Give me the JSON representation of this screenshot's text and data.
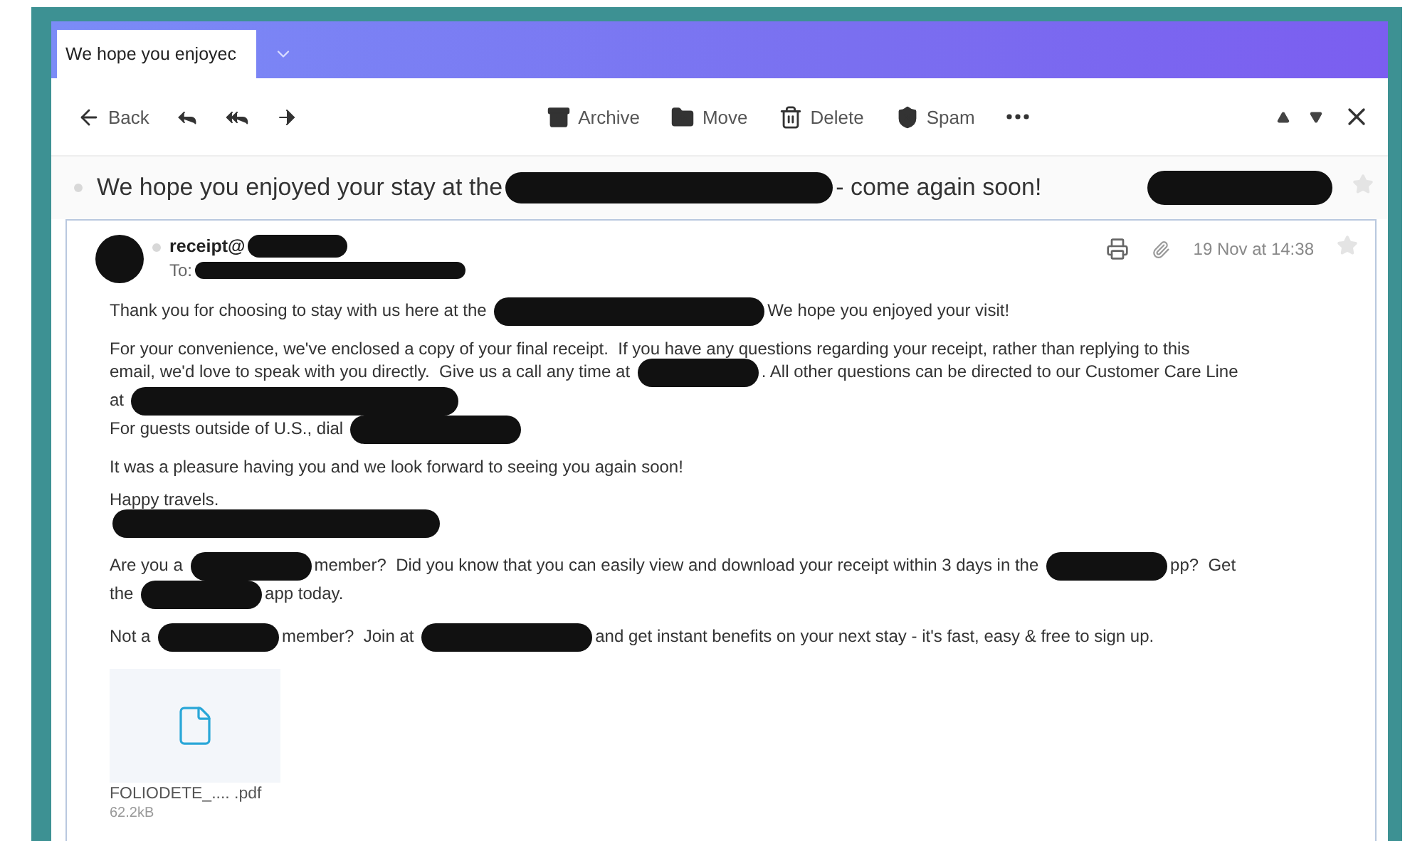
{
  "tab": {
    "title": "We hope you enjoyec"
  },
  "toolbar": {
    "left": [
      {
        "kind": "back",
        "label": "Back"
      },
      {
        "kind": "reply"
      },
      {
        "kind": "reply_all"
      },
      {
        "kind": "forward"
      }
    ],
    "center": [
      {
        "kind": "archive",
        "label": "Archive"
      },
      {
        "kind": "move",
        "label": "Move"
      },
      {
        "kind": "delete",
        "label": "Delete"
      },
      {
        "kind": "spam",
        "label": "Spam"
      },
      {
        "kind": "more"
      }
    ],
    "right": [
      {
        "kind": "up"
      },
      {
        "kind": "down"
      },
      {
        "kind": "close"
      }
    ]
  },
  "subject": {
    "starred": false,
    "parts": [
      {
        "kind": "text",
        "text": "We hope you enjoyed your stay at the"
      },
      {
        "kind": "redaction_xl"
      },
      {
        "kind": "text",
        "text": "- come again soon!"
      }
    ]
  },
  "message": {
    "starred": false,
    "from": "receipt@",
    "to_label": "To:",
    "date": "19 Nov at 14:38",
    "paragraphs": [
      {
        "parts": [
          {
            "kind": "text",
            "text": "Thank you for choosing to stay with us here at the"
          },
          {
            "kind": "redaction_l"
          },
          {
            "kind": "text",
            "text": "We hope you enjoyed your visit!"
          }
        ]
      },
      {
        "parts": [
          {
            "kind": "text",
            "text": "For your convenience, we've enclosed a copy of your final receipt.  If you have any questions regarding your receipt, rather than replying to this"
          },
          {
            "kind": "break"
          },
          {
            "kind": "text",
            "text": "email, we'd love to speak with you directly.  Give us a call any time at"
          },
          {
            "kind": "redaction_s"
          },
          {
            "kind": "text",
            "text": ". All other questions can be directed to our Customer Care Line"
          },
          {
            "kind": "break"
          },
          {
            "kind": "text",
            "text": "at"
          },
          {
            "kind": "redaction_xl"
          },
          {
            "kind": "break"
          },
          {
            "kind": "text",
            "text": "For guests outside of U.S., dial"
          },
          {
            "kind": "redaction_m"
          }
        ]
      },
      {
        "parts": [
          {
            "kind": "text",
            "text": "It was a pleasure having you and we look forward to seeing you again soon!"
          }
        ]
      },
      {
        "parts": [
          {
            "kind": "text",
            "text": "Happy travels."
          },
          {
            "kind": "break"
          },
          {
            "kind": "redaction_xl"
          }
        ]
      },
      {
        "parts": [
          {
            "kind": "text",
            "text": "Are you a"
          },
          {
            "kind": "redaction_s"
          },
          {
            "kind": "text",
            "text": "member?  Did you know that you can easily view and download your receipt within 3 days in the"
          },
          {
            "kind": "redaction_s"
          },
          {
            "kind": "text",
            "text": "pp?  Get"
          },
          {
            "kind": "break"
          },
          {
            "kind": "text",
            "text": "the"
          },
          {
            "kind": "redaction_s"
          },
          {
            "kind": "text",
            "text": "app today."
          }
        ]
      },
      {
        "parts": [
          {
            "kind": "text",
            "text": "Not a"
          },
          {
            "kind": "redaction_s"
          },
          {
            "kind": "text",
            "text": "member?  Join at"
          },
          {
            "kind": "redaction_m"
          },
          {
            "kind": "text",
            "text": "and get instant benefits on your next stay - it's fast, easy & free to sign up."
          }
        ]
      }
    ],
    "attachment": {
      "name": "FOLIODETE_.... .pdf",
      "size": "62.2kB"
    }
  }
}
